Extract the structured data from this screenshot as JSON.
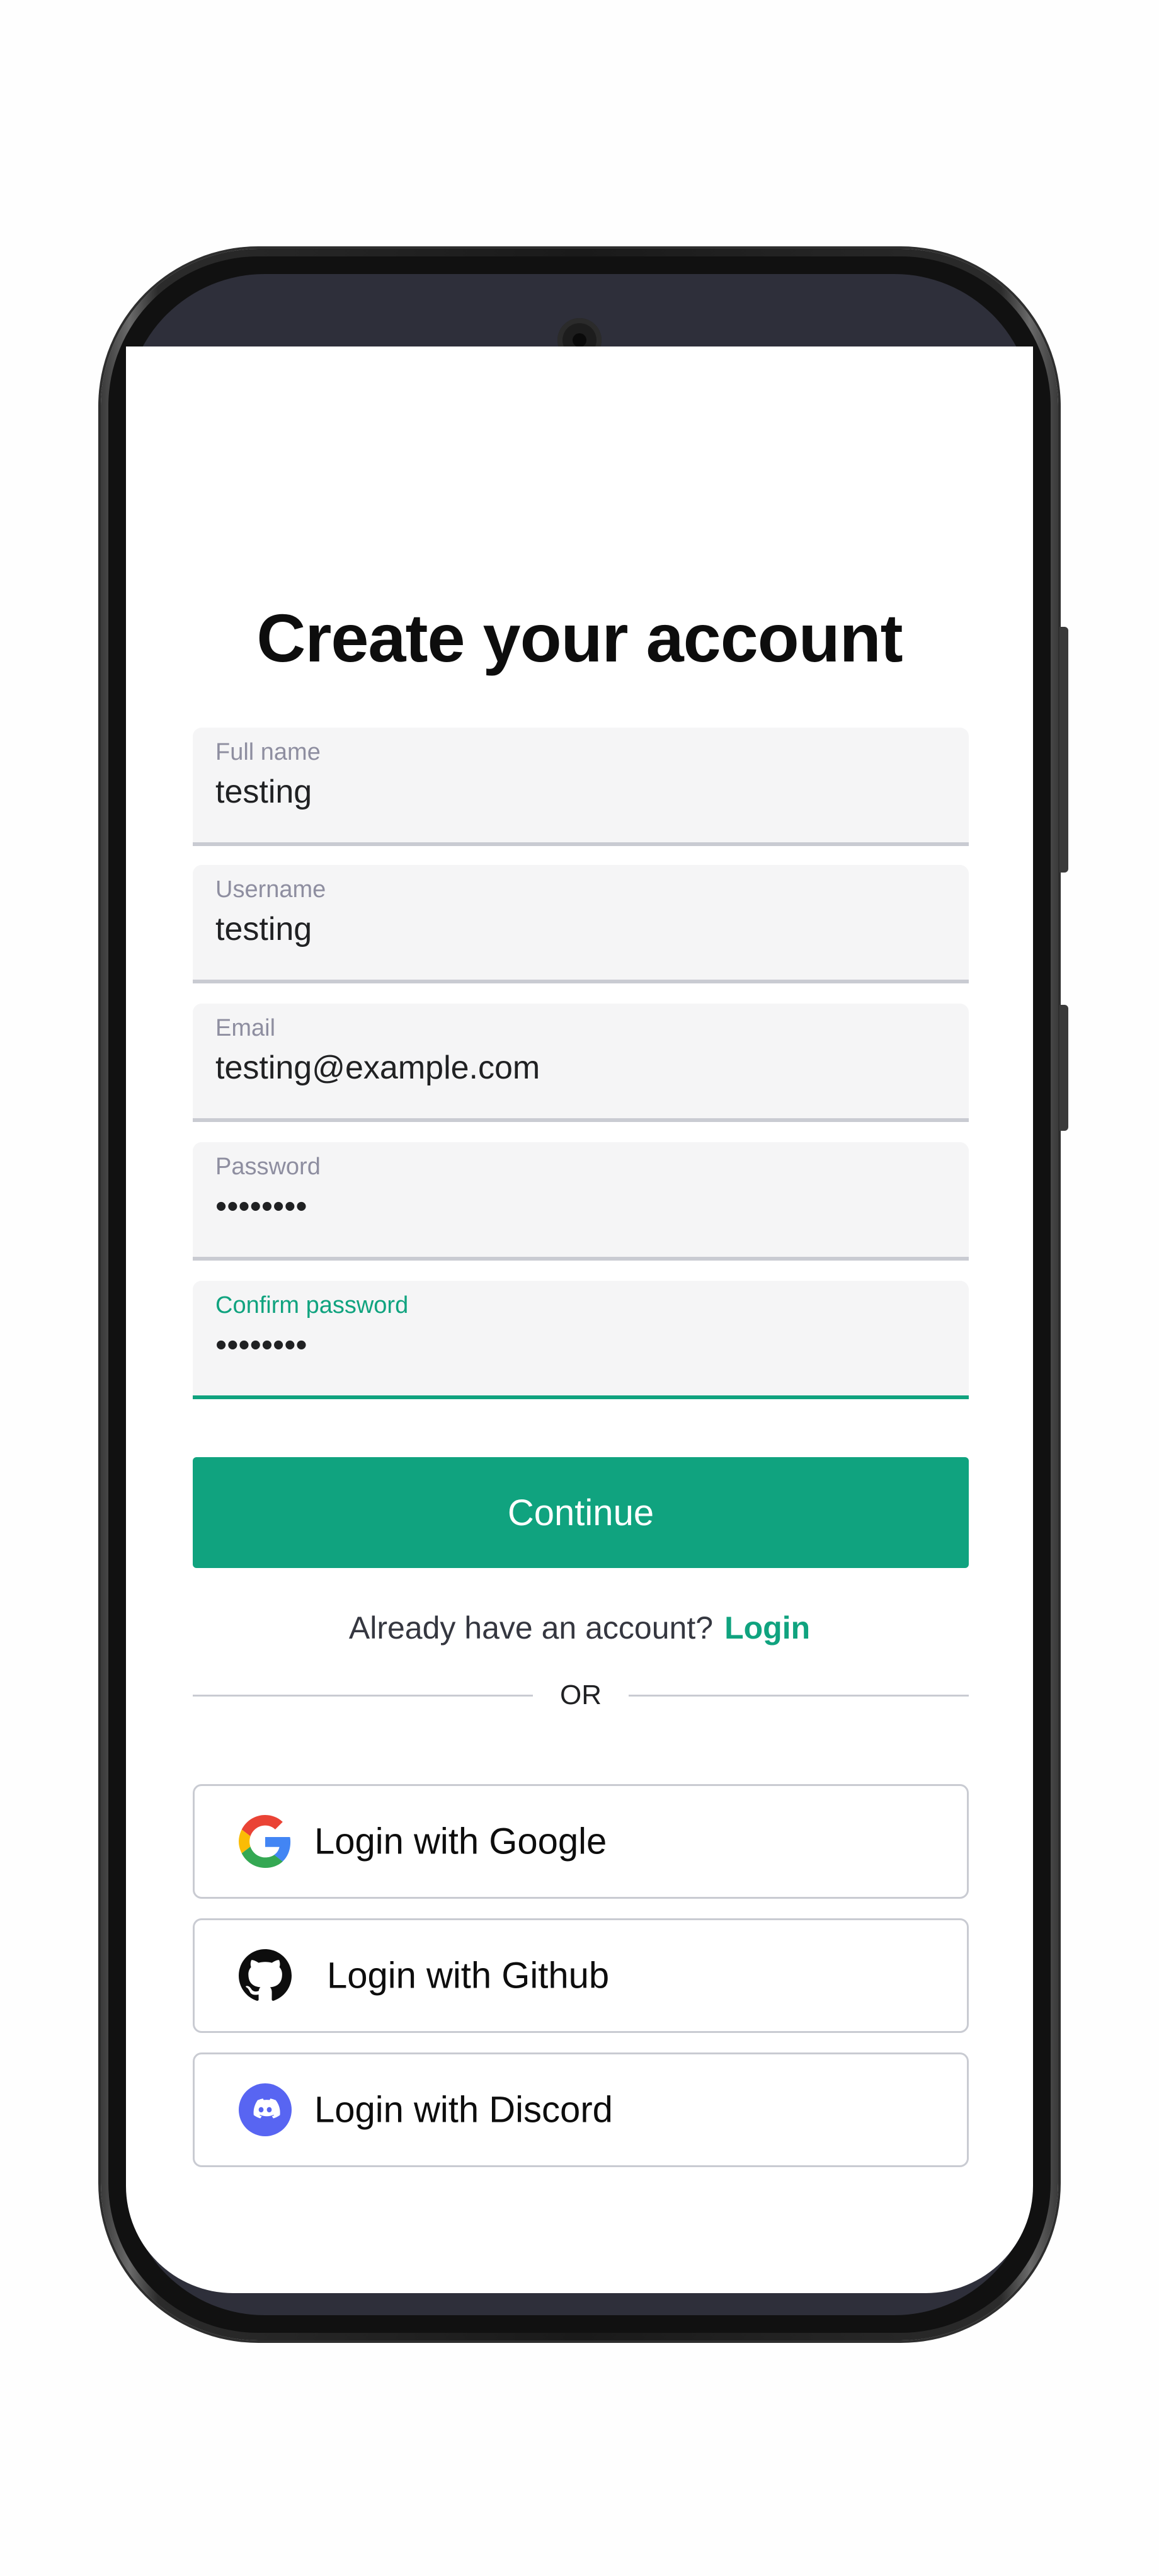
{
  "page": {
    "title": "Create your account"
  },
  "form": {
    "full_name": {
      "label": "Full name",
      "value": "testing"
    },
    "username": {
      "label": "Username",
      "value": "testing"
    },
    "email": {
      "label": "Email",
      "value": "testing@example.com"
    },
    "password": {
      "label": "Password",
      "value": "••••••••"
    },
    "confirm_password": {
      "label": "Confirm password",
      "value": "••••••••"
    },
    "continue_label": "Continue"
  },
  "login_prompt": {
    "text": "Already have an account?",
    "link": "Login"
  },
  "divider": {
    "text": "OR"
  },
  "social": [
    {
      "label": "Login with Google",
      "icon": "google-icon"
    },
    {
      "label": "Login with Github",
      "icon": "github-icon"
    },
    {
      "label": "Login with Discord",
      "icon": "discord-icon"
    }
  ],
  "colors": {
    "accent": "#10a37f",
    "discord": "#5865f2"
  }
}
